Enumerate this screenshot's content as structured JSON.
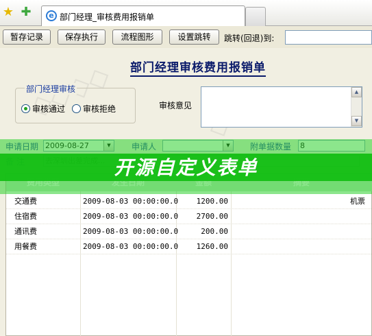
{
  "browser": {
    "tab_title": "部门经理_审核费用报销单"
  },
  "toolbar": {
    "buttons": [
      "暂存记录",
      "保存执行",
      "流程图形",
      "设置跳转"
    ],
    "jump_label": "跳转(回退)到:"
  },
  "form": {
    "title": "部门经理审核费用报销单",
    "audit_group_label": "部门经理审核",
    "audit_options": [
      "审核通过",
      "审核拒绝"
    ],
    "audit_selected": "审核通过",
    "opinion_label": "审核意见",
    "fields": {
      "apply_date_label": "申请日期",
      "apply_date": "2009-08-27",
      "applicant_label": "申请人",
      "attachments_label": "附单据数量",
      "attachments": "8",
      "remark_label": "备  注",
      "remark": "去深圳出差完成..."
    }
  },
  "banner": {
    "text": "开源自定义表单"
  },
  "table": {
    "headers": [
      "费用类型",
      "发生日期",
      "金额",
      "摘要"
    ],
    "rows": [
      [
        "交通费",
        "2009-08-03 00:00:00.0",
        "1200.00",
        "机票"
      ],
      [
        "住宿费",
        "2009-08-03 00:00:00.0",
        "2700.00",
        ""
      ],
      [
        "通讯费",
        "2009-08-03 00:00:00.0",
        "200.00",
        ""
      ],
      [
        "用餐费",
        "2009-08-03 00:00:00.0",
        "1260.00",
        ""
      ]
    ]
  },
  "colors": {
    "accent_green": "#14be14",
    "title_blue": "#0a1a6a",
    "label_blue": "#1a3ca0"
  }
}
